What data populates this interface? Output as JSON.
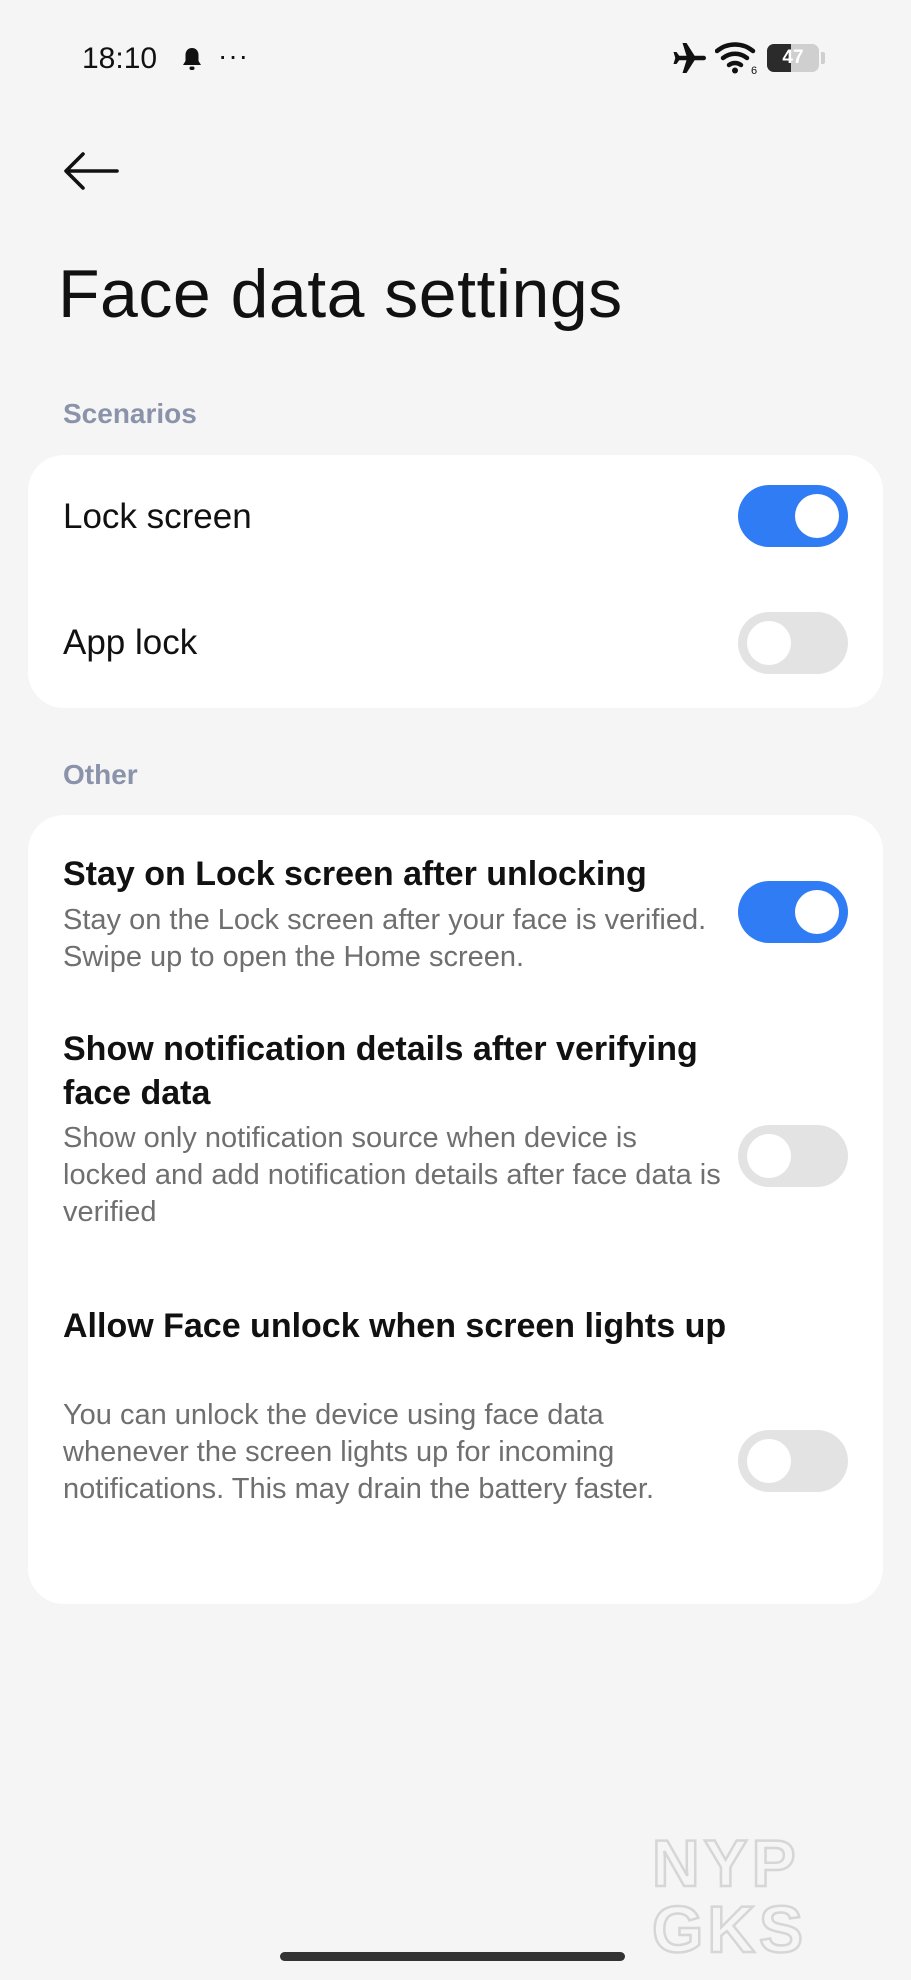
{
  "status_bar": {
    "time": "18:10",
    "dots": "···",
    "battery_percent": 47,
    "battery_label": "47",
    "wifi_label": "6",
    "icons": [
      "bell-icon",
      "airplane-icon",
      "wifi-icon",
      "battery-icon"
    ]
  },
  "header": {
    "title": "Face data settings"
  },
  "sections": {
    "scenarios": {
      "label": "Scenarios",
      "items": [
        {
          "title": "Lock screen",
          "enabled": true
        },
        {
          "title": "App lock",
          "enabled": false
        }
      ]
    },
    "other": {
      "label": "Other",
      "items": [
        {
          "title": "Stay on Lock screen after unlocking",
          "subtitle": "Stay on the Lock screen after your face is verified. Swipe up to open the Home screen.",
          "enabled": true
        },
        {
          "title": "Show notification details after verifying face data",
          "subtitle": "Show only notification source when device is locked and add notification details after face data is verified",
          "enabled": false
        },
        {
          "title": "Allow Face unlock when screen lights up",
          "subtitle": "You can unlock the device using face data whenever the screen lights up for incoming notifications. This may drain the battery faster.",
          "enabled": false
        }
      ]
    }
  },
  "watermark": {
    "line1": "NYP",
    "line2": "GKS"
  },
  "colors": {
    "accent": "#2f7cf5",
    "toggle_off": "#e3e3e3",
    "section_header": "#8a93aa",
    "background": "#f5f5f5"
  }
}
